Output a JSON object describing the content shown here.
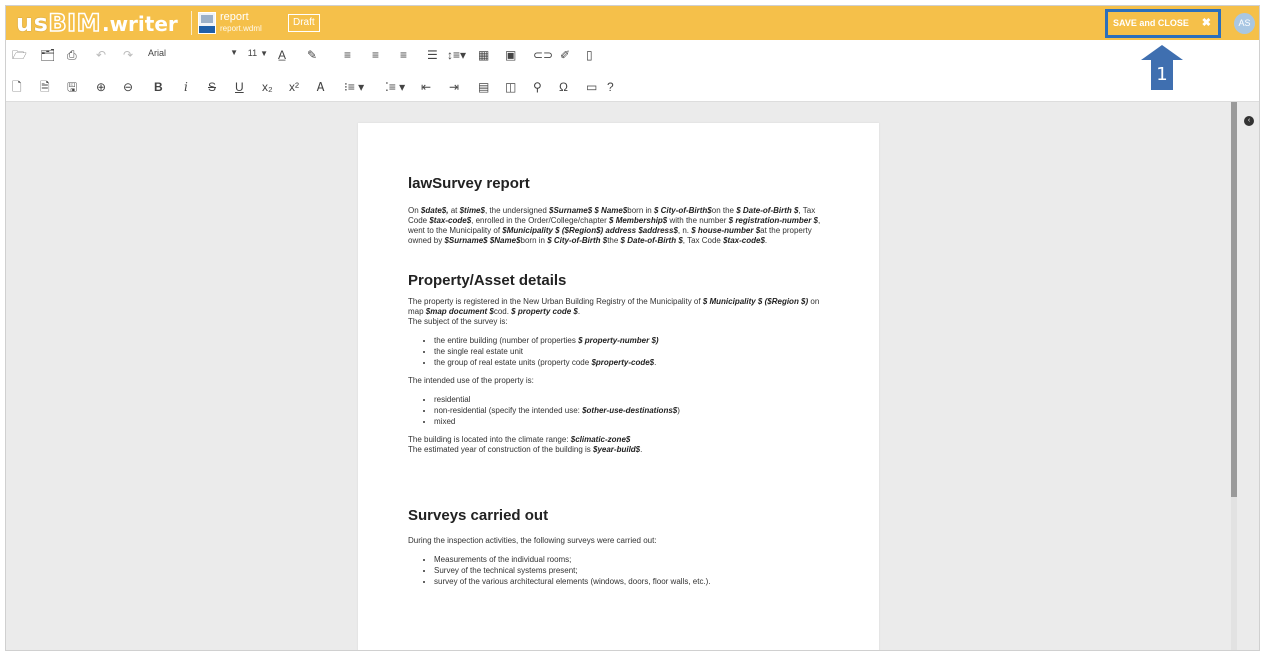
{
  "header": {
    "logo_us": "us",
    "logo_bim": "BIM",
    "logo_writer": ".writer",
    "doc_title": "report",
    "doc_file": "report.wdml",
    "status": "Draft",
    "save_close_label": "SAVE and CLOSE",
    "save_close_icon": "close-icon",
    "avatar_initials": "AS",
    "colors": {
      "header_bg": "#f5c04a",
      "highlight": "#2b6fbc",
      "avatar_bg": "#a9c7e3"
    }
  },
  "toolbar": {
    "font": "Arial",
    "size": "11"
  },
  "annotation": {
    "number": "1"
  },
  "document": {
    "title": "lawSurvey report",
    "intro": [
      {
        "t": "On "
      },
      {
        "b": "$date$,"
      },
      {
        "t": " at "
      },
      {
        "b": "$time$"
      },
      {
        "t": ", the undersigned "
      },
      {
        "b": "$Surname$ $ Name$"
      },
      {
        "t": "born in "
      },
      {
        "b": "$ City-of-Birth$"
      },
      {
        "t": "on the "
      },
      {
        "b": "$ Date-of-Birth $"
      },
      {
        "t": ", Tax Code "
      },
      {
        "b": "$tax-code$"
      },
      {
        "t": ", enrolled in the Order/College/chapter "
      },
      {
        "b": "$ Membership$"
      },
      {
        "t": " with the number "
      },
      {
        "b": "$ registration-number $"
      },
      {
        "t": ", went to the Municipality of "
      },
      {
        "b": "$Municipality $ ($Region$) address $address$"
      },
      {
        "t": ", n. "
      },
      {
        "b": "$ house-number $"
      },
      {
        "t": "at the property owned by "
      },
      {
        "b": "$Surname$ $Name$"
      },
      {
        "t": "born in "
      },
      {
        "b": "$ City-of-Birth $"
      },
      {
        "t": "the "
      },
      {
        "b": "$ Date-of-Birth $"
      },
      {
        "t": ", Tax Code "
      },
      {
        "b": "$tax-code$"
      },
      {
        "t": "."
      }
    ],
    "section2_title": "Property/Asset details",
    "registry": [
      {
        "t": "The property is registered in the New Urban Building Registry of the Municipality of "
      },
      {
        "b": "$ Municipality $ ($Region $)"
      },
      {
        "t": " on map "
      },
      {
        "b": "$map document $"
      },
      {
        "t": "cod. "
      },
      {
        "b": "$ property code $"
      },
      {
        "t": "."
      }
    ],
    "subject_line": "The subject of the survey is:",
    "subject_items": [
      [
        {
          "t": "the entire building (number of properties "
        },
        {
          "b": "$ property-number $)"
        }
      ],
      [
        {
          "t": "the single real estate unit"
        }
      ],
      [
        {
          "t": "the group of real estate units  (property code "
        },
        {
          "b": "$property-code$"
        },
        {
          "t": "."
        }
      ]
    ],
    "use_line": "The intended use of the property is:",
    "use_items": [
      [
        {
          "t": "residential"
        }
      ],
      [
        {
          "t": "non-residential (specify the intended use: "
        },
        {
          "b": "$other-use-destinations$"
        },
        {
          "t": ")"
        }
      ],
      [
        {
          "t": "mixed"
        }
      ]
    ],
    "climate": [
      {
        "t": "The building is located into the climate range: "
      },
      {
        "b": "$climatic-zone$"
      }
    ],
    "year": [
      {
        "t": "The estimated year of construction of the building is "
      },
      {
        "b": "$year-build$"
      },
      {
        "t": "."
      }
    ],
    "section3_title": "Surveys carried out",
    "surveys_intro": "During the inspection activities, the following surveys were carried out:",
    "survey_items": [
      [
        {
          "t": "Measurements of the individual rooms;"
        }
      ],
      [
        {
          "t": "Survey of the technical systems present;"
        }
      ],
      [
        {
          "t": "survey of the various architectural elements (windows, doors, floor walls, etc.)."
        }
      ]
    ]
  }
}
